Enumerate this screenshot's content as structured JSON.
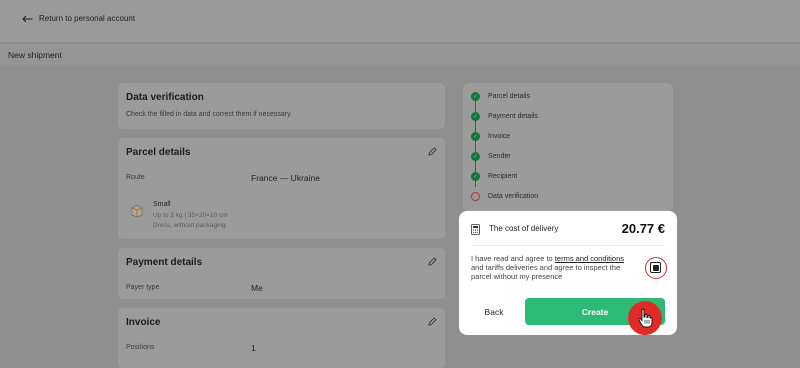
{
  "topbar": {
    "back_label": "Return to personal account"
  },
  "subbar": {
    "title": "New shipment"
  },
  "verification": {
    "title": "Data verification",
    "subtitle": "Check the filled in data and correct them if necessary."
  },
  "parcel": {
    "title": "Parcel details",
    "route_label": "Route",
    "route_value": "France — Ukraine",
    "package_name": "Small",
    "package_size": "Up to 2 kg | 35×20×10 cm",
    "package_desc": "Dress, without packaging"
  },
  "payment": {
    "title": "Payment details",
    "payer_label": "Payer type",
    "payer_value": "Me"
  },
  "invoice": {
    "title": "Invoice",
    "positions_label": "Positions",
    "positions_value": "1"
  },
  "steps": [
    {
      "label": "Parcel details",
      "state": "done"
    },
    {
      "label": "Payment details",
      "state": "done"
    },
    {
      "label": "Invoice",
      "state": "done"
    },
    {
      "label": "Sender",
      "state": "done"
    },
    {
      "label": "Recipient",
      "state": "done"
    },
    {
      "label": "Data verification",
      "state": "current"
    }
  ],
  "modal": {
    "cost_label": "The cost of delivery",
    "cost_value": "20.77 €",
    "agree_prefix": "I have read and agree to ",
    "agree_link": "terms and conditions",
    "agree_suffix": " and tariffs deliveries and agree to inspect the parcel without my presence",
    "checkbox_checked": true,
    "back_label": "Back",
    "create_label": "Create"
  },
  "colors": {
    "accent": "#2dba74",
    "step_done": "#0f7a3b",
    "highlight": "#e02c28"
  }
}
